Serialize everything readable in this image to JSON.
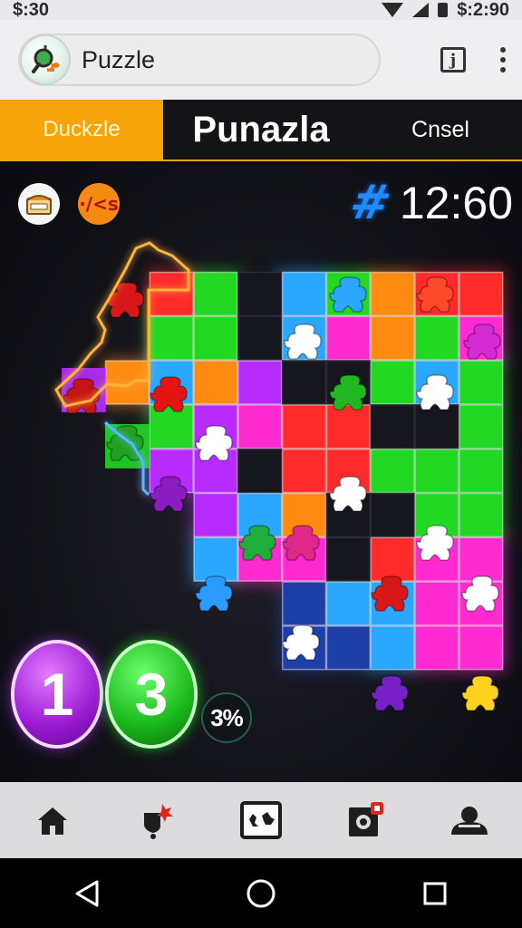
{
  "status_bar": {
    "time_left": "$:30",
    "time_right": "$:2:90"
  },
  "app_bar": {
    "title": "Puzzle",
    "logo_icon": "magnifier-puzzle-icon",
    "info_icon_glyph": "j",
    "menu_icon": "kebab-menu-icon"
  },
  "tabs": [
    {
      "label": "Duckzle",
      "selected": true
    },
    {
      "label": "Punazla",
      "selected": false
    },
    {
      "label": "Cnsel",
      "selected": false
    }
  ],
  "game": {
    "mini_button_1_icon": "treasure-chest-icon",
    "mini_button_2_label": "·/<s",
    "timer_icon": "hash-icon",
    "timer": "12:60",
    "badge_1": "1",
    "badge_2": "3",
    "small_badge": "3%"
  },
  "bottom_nav": [
    {
      "name": "home",
      "icon": "home-icon"
    },
    {
      "name": "alerts",
      "icon": "bell-alert-icon"
    },
    {
      "name": "puzzle",
      "icon": "puzzle-board-icon"
    },
    {
      "name": "camera",
      "icon": "camera-notification-icon"
    },
    {
      "name": "profile",
      "icon": "user-icon"
    }
  ],
  "system_nav": [
    "back-icon",
    "home-circle-icon",
    "recents-icon"
  ],
  "colors": {
    "tab_accent": "#f7a40a",
    "red": "#ff2b2b",
    "green": "#22d822",
    "blue": "#2aa7ff",
    "purple": "#b72bff",
    "orange": "#ff8a12",
    "magenta": "#ff2bd0"
  }
}
